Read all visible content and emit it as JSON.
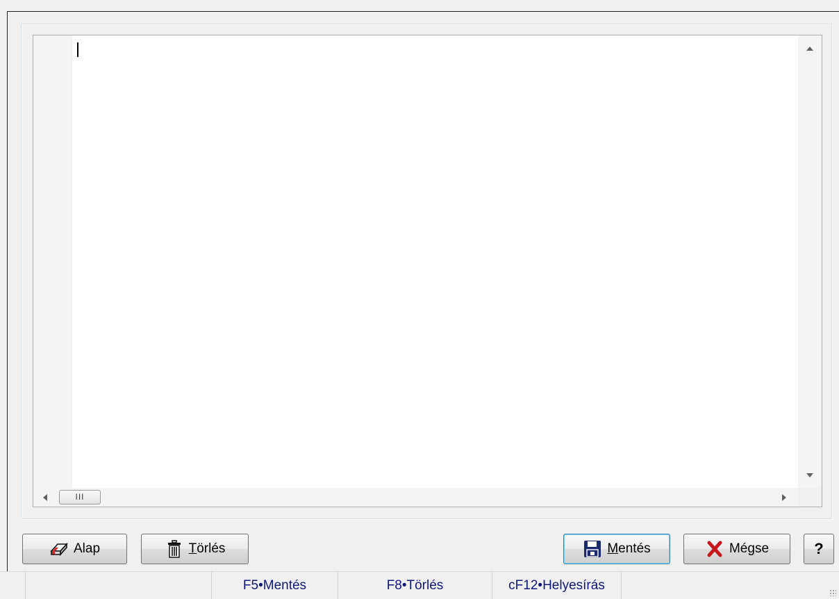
{
  "editor": {
    "content": "",
    "hscroll_thumb_grip": "III"
  },
  "buttons": {
    "alap": {
      "label": "Alap"
    },
    "torles": {
      "mnemonic": "T",
      "rest": "örlés"
    },
    "mentes": {
      "mnemonic": "M",
      "rest": "entés"
    },
    "megse": {
      "label": "Mégse"
    },
    "help": {
      "label": "?"
    }
  },
  "statusbar": {
    "items": [
      "",
      "F5•Mentés",
      "F8•Törlés",
      "cF12•Helyesírás"
    ]
  },
  "colors": {
    "status_text": "#10177a",
    "cancel_icon": "#c8161d",
    "save_icon": "#1a2a6c"
  }
}
